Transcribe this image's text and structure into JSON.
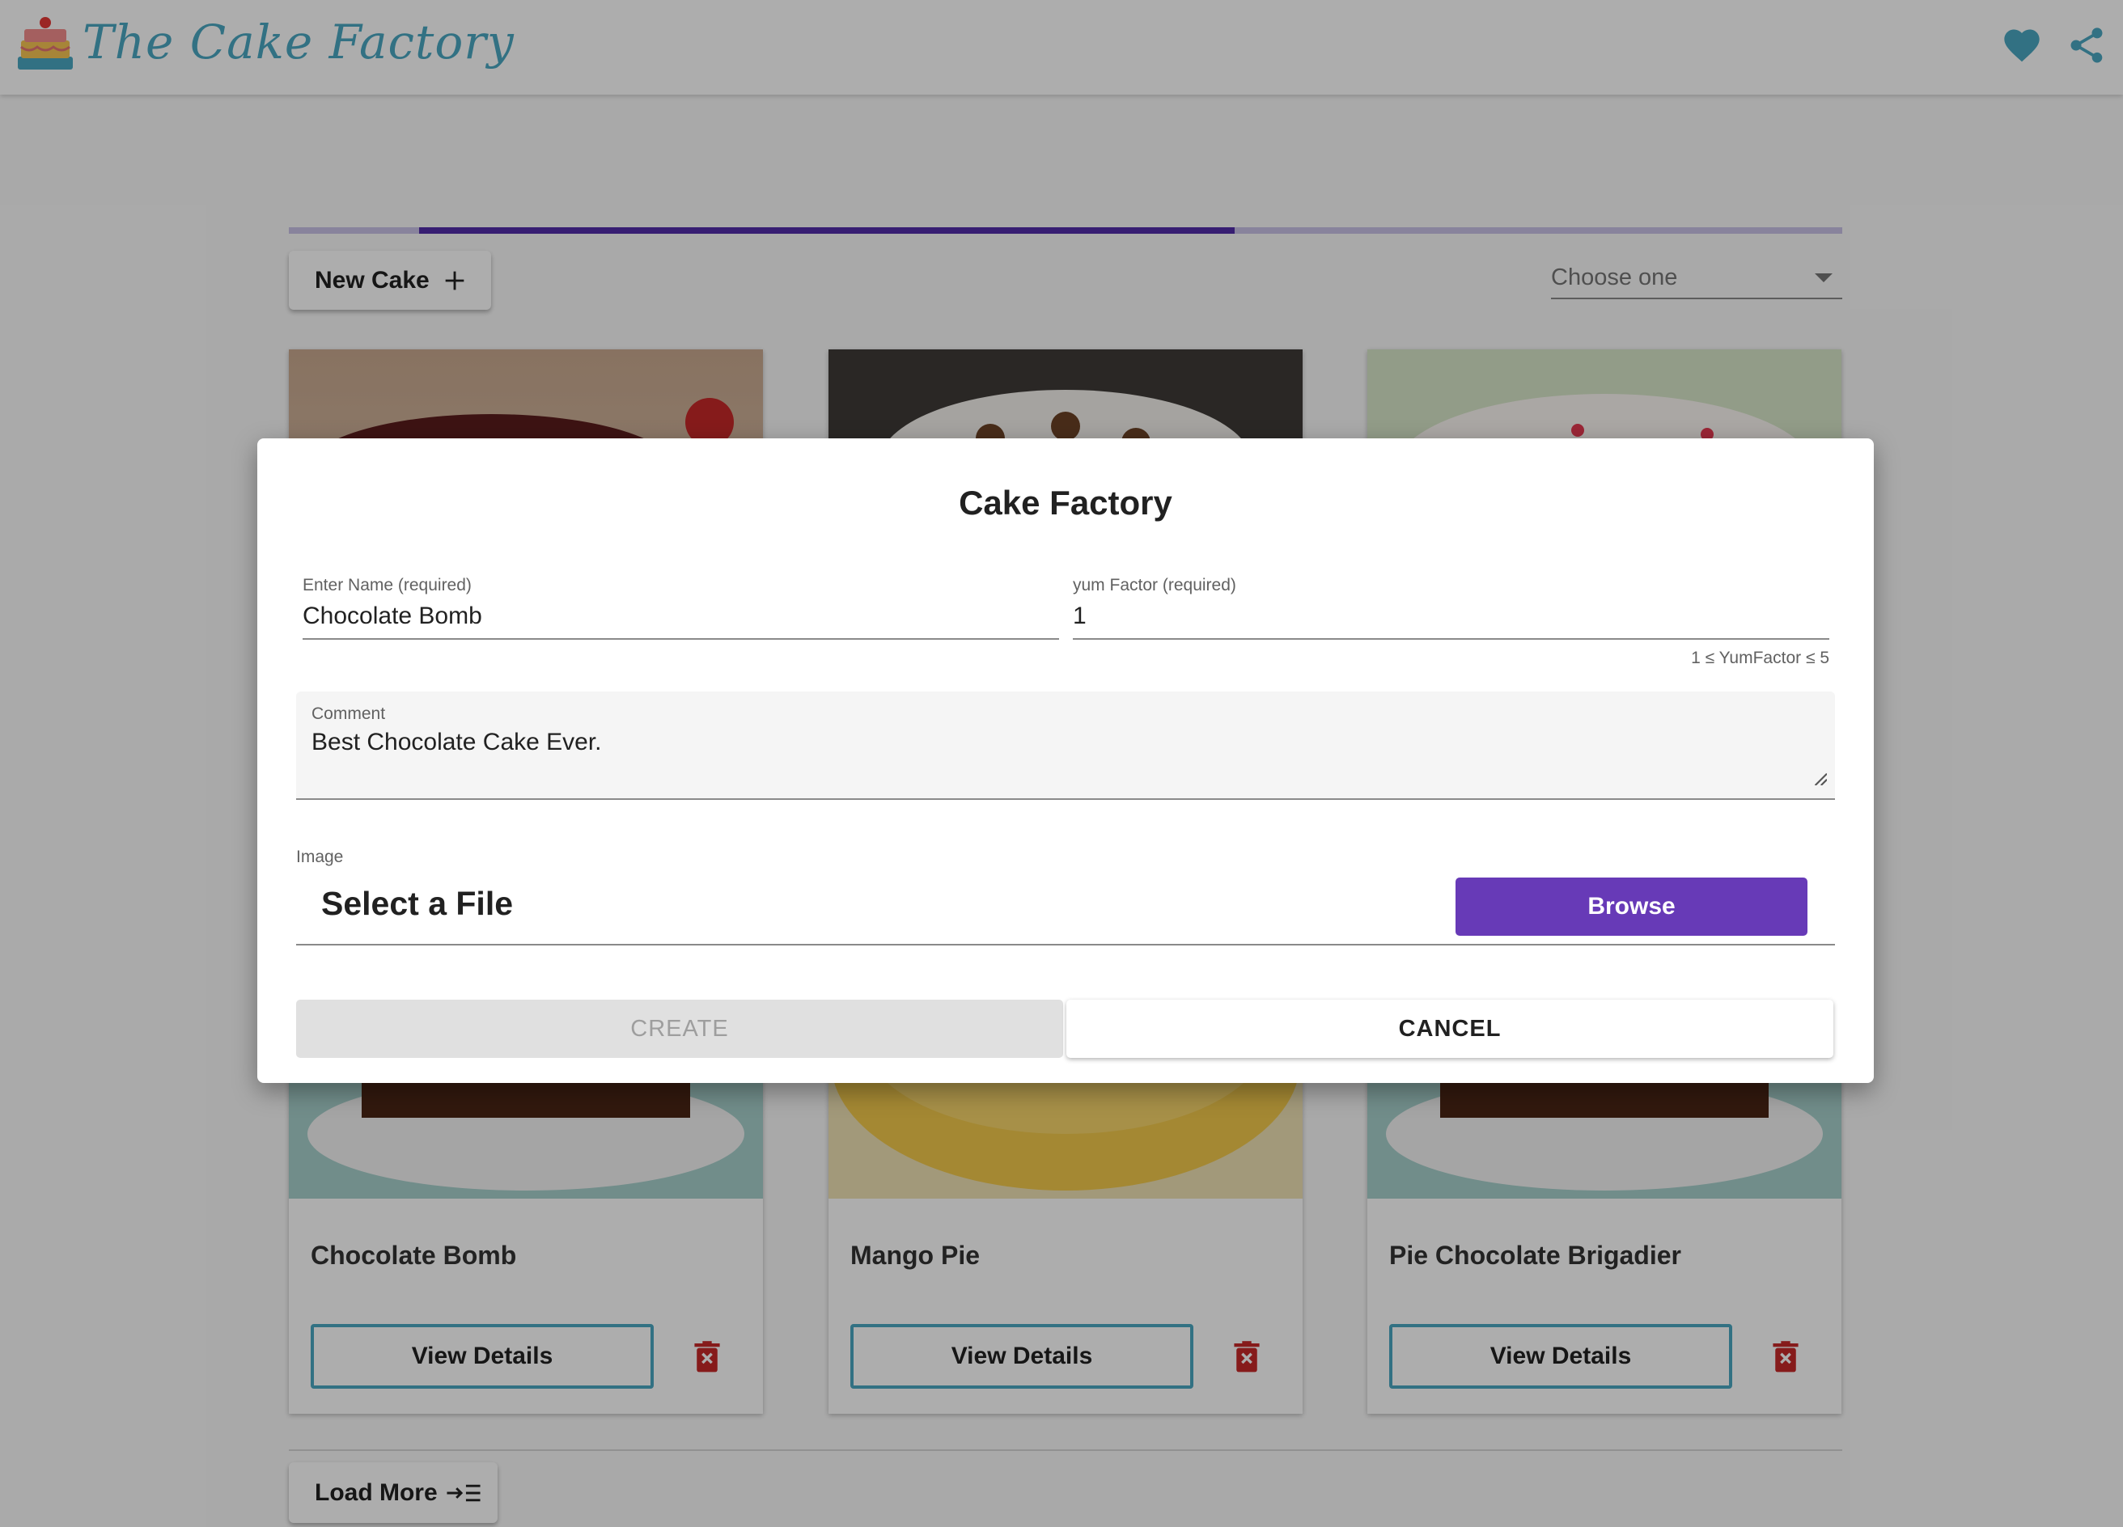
{
  "header": {
    "brand": "The Cake Factory",
    "icons": [
      "cake-logo-icon",
      "heart-icon",
      "share-icon"
    ]
  },
  "progress": {
    "start_fraction": 0.084,
    "end_fraction": 0.609
  },
  "toolbar": {
    "new_cake_label": "New Cake",
    "new_cake_icon": "plus-icon",
    "sort_select_placeholder": "Choose one"
  },
  "cards": [
    {
      "title": "Chocolate Bomb",
      "button_label": "View Details",
      "delete_icon": "trash-icon"
    },
    {
      "title": "Mango Pie",
      "button_label": "View Details",
      "delete_icon": "trash-icon"
    },
    {
      "title": "Pie Chocolate Brigadier",
      "button_label": "View Details",
      "delete_icon": "trash-icon"
    }
  ],
  "footer": {
    "load_more_label": "Load More",
    "load_more_icon": "load-more-icon"
  },
  "dialog": {
    "title": "Cake Factory",
    "name_label": "Enter Name (required)",
    "name_value": "Chocolate Bomb",
    "yum_label": "yum Factor (required)",
    "yum_value": "1",
    "yum_hint": "1 ≤ YumFactor ≤ 5",
    "comment_label": "Comment",
    "comment_value": "Best Chocolate Cake Ever.",
    "image_label": "Image",
    "file_placeholder": "Select a File",
    "browse_label": "Browse",
    "create_label": "CREATE",
    "cancel_label": "CANCEL"
  },
  "colors": {
    "accent": "#4aa7c1",
    "primary": "#673ab7",
    "progress": "#512da8",
    "danger": "#c62828"
  }
}
